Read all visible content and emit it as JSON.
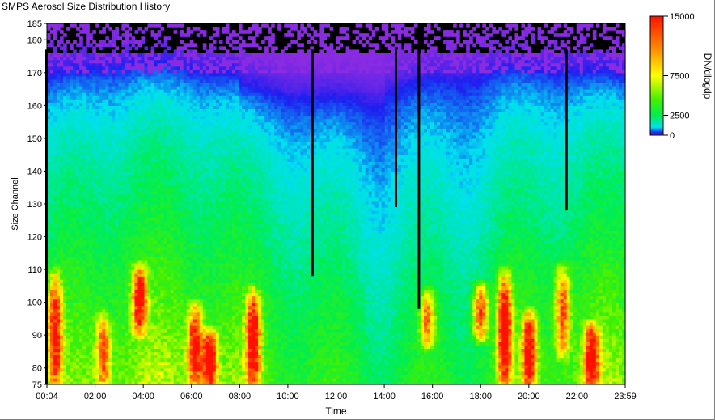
{
  "window": {
    "title": "SMPS Aerosol Size Distribution History"
  },
  "colors": {
    "lines": "#000000",
    "frame": "#000000",
    "empty": "#000000"
  },
  "chart_data": {
    "type": "heatmap",
    "title": "SMPS Aerosol Size Distribution History",
    "xlabel": "Time",
    "ylabel": "Size Channel",
    "x_ticks": [
      "00:04",
      "02:00",
      "04:00",
      "06:00",
      "08:00",
      "10:00",
      "12:00",
      "14:00",
      "16:00",
      "18:00",
      "20:00",
      "22:00",
      "23:59"
    ],
    "y_ticks": [
      185,
      180,
      170,
      160,
      150,
      140,
      130,
      120,
      110,
      100,
      90,
      80,
      75
    ],
    "ylim": [
      75,
      185
    ],
    "x_start_hour": 0.0667,
    "x_end_hour": 23.9833,
    "colorbar": {
      "label": "DN/dlogdp",
      "range": [
        0,
        15000
      ],
      "ticks": [
        "15000",
        "7500",
        "2500",
        "0"
      ],
      "tick_values": [
        15000,
        7500,
        2500,
        0
      ],
      "stops": [
        {
          "v": 0,
          "color": "#8a2be2"
        },
        {
          "v": 300,
          "color": "#1e1ef0"
        },
        {
          "v": 1000,
          "color": "#00e0f0"
        },
        {
          "v": 2500,
          "color": "#00ee50"
        },
        {
          "v": 4500,
          "color": "#44f000"
        },
        {
          "v": 7500,
          "color": "#ffff00"
        },
        {
          "v": 11000,
          "color": "#ff8800"
        },
        {
          "v": 15000,
          "color": "#ff1000"
        }
      ]
    },
    "baseline_profile": [
      {
        "channel": 75,
        "value": 5200
      },
      {
        "channel": 90,
        "value": 4200
      },
      {
        "channel": 110,
        "value": 3200
      },
      {
        "channel": 120,
        "value": 2600
      },
      {
        "channel": 135,
        "value": 2000
      },
      {
        "channel": 150,
        "value": 1400
      },
      {
        "channel": 160,
        "value": 900
      },
      {
        "channel": 165,
        "value": 600
      },
      {
        "channel": 170,
        "value": 250
      },
      {
        "channel": 176,
        "value": 80
      },
      {
        "channel": 182,
        "value": 0
      }
    ],
    "plume_events": [
      {
        "hour": 0.4,
        "from": 75,
        "to": 108,
        "peak": 12000
      },
      {
        "hour": 2.4,
        "from": 75,
        "to": 95,
        "peak": 9000
      },
      {
        "hour": 3.9,
        "from": 92,
        "to": 110,
        "peak": 13000
      },
      {
        "hour": 6.2,
        "from": 75,
        "to": 98,
        "peak": 12000
      },
      {
        "hour": 6.8,
        "from": 75,
        "to": 90,
        "peak": 14500
      },
      {
        "hour": 8.6,
        "from": 75,
        "to": 102,
        "peak": 14500
      },
      {
        "hour": 15.8,
        "from": 88,
        "to": 102,
        "peak": 9000
      },
      {
        "hour": 18.0,
        "from": 90,
        "to": 104,
        "peak": 11000
      },
      {
        "hour": 19.0,
        "from": 75,
        "to": 108,
        "peak": 15000
      },
      {
        "hour": 20.0,
        "from": 75,
        "to": 96,
        "peak": 13500
      },
      {
        "hour": 21.4,
        "from": 85,
        "to": 110,
        "peak": 10000
      },
      {
        "hour": 22.6,
        "from": 75,
        "to": 92,
        "peak": 14000
      }
    ],
    "instrument_gaps": [
      {
        "hour": 0.05,
        "down_to": 75
      },
      {
        "hour": 11.05,
        "down_to": 108
      },
      {
        "hour": 14.5,
        "down_to": 129
      },
      {
        "hour": 15.45,
        "down_to": 98
      },
      {
        "hour": 21.55,
        "down_to": 128
      }
    ]
  }
}
